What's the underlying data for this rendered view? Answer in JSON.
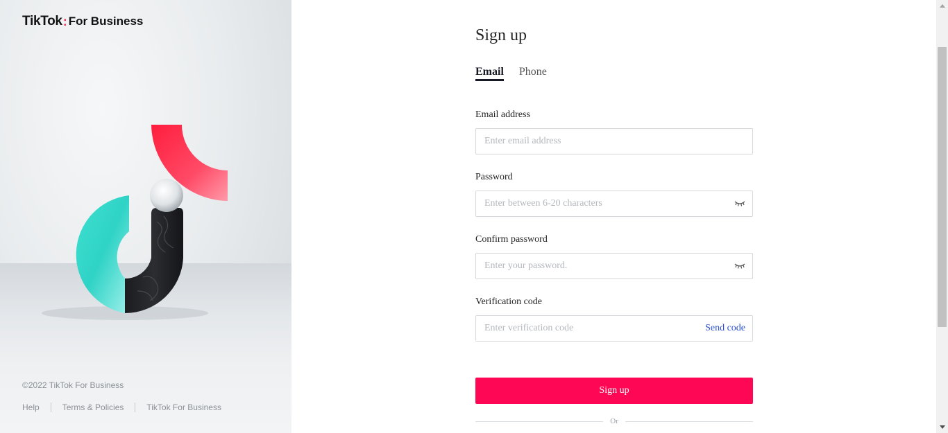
{
  "brand": {
    "logo_main": "TikTok",
    "logo_separator": ":",
    "logo_sub": "For Business",
    "accent_color": "#fe0856",
    "link_color": "#2a4fd1"
  },
  "footer": {
    "copyright": "©2022 TikTok For Business",
    "links": [
      "Help",
      "Terms & Policies",
      "TikTok For Business"
    ]
  },
  "form": {
    "title": "Sign up",
    "tabs": [
      {
        "label": "Email",
        "active": true
      },
      {
        "label": "Phone",
        "active": false
      }
    ],
    "email": {
      "label": "Email address",
      "placeholder": "Enter email address"
    },
    "password": {
      "label": "Password",
      "placeholder": "Enter between 6-20 characters",
      "icon": "eye-closed-icon"
    },
    "confirm": {
      "label": "Confirm password",
      "placeholder": "Enter your password.",
      "icon": "eye-closed-icon"
    },
    "verification": {
      "label": "Verification code",
      "placeholder": "Enter verification code",
      "action": "Send code"
    },
    "submit_label": "Sign up",
    "divider_text": "Or"
  }
}
